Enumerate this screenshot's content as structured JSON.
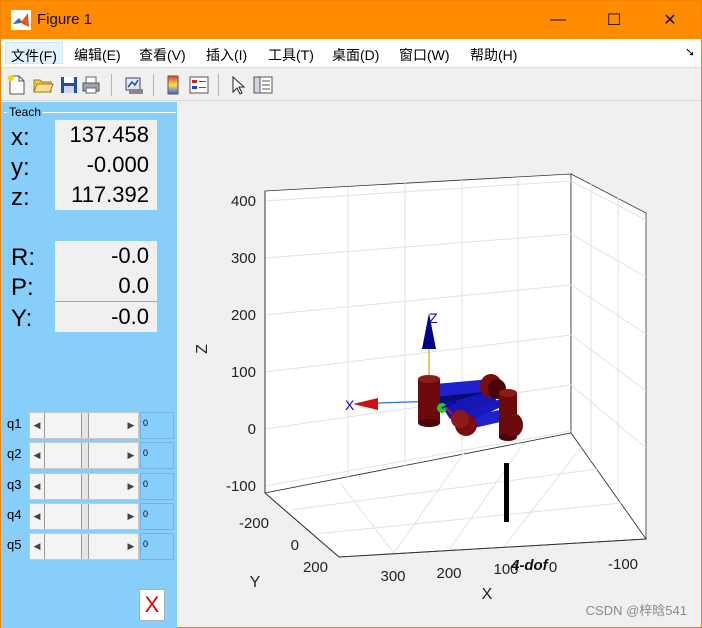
{
  "window": {
    "title": "Figure 1",
    "minimize_glyph": "—",
    "maximize_glyph": "☐",
    "close_glyph": "✕"
  },
  "menu": [
    {
      "label": "文件(F)"
    },
    {
      "label": "编辑(E)"
    },
    {
      "label": "查看(V)"
    },
    {
      "label": "插入(I)"
    },
    {
      "label": "工具(T)"
    },
    {
      "label": "桌面(D)"
    },
    {
      "label": "窗口(W)"
    },
    {
      "label": "帮助(H)"
    }
  ],
  "toolbar": {
    "icons": [
      "new-file-icon",
      "open-folder-icon",
      "save-icon",
      "print-icon",
      "link-plot-icon",
      "colorbar-icon",
      "legend-icon",
      "pointer-icon",
      "property-editor-icon"
    ]
  },
  "teach_panel": {
    "title": "Teach",
    "position": [
      {
        "label": "x:",
        "value": "137.458"
      },
      {
        "label": "y:",
        "value": "-0.000"
      },
      {
        "label": "z:",
        "value": "117.392"
      }
    ],
    "orientation": [
      {
        "label": "R:",
        "value": "-0.0"
      },
      {
        "label": "P:",
        "value": "0.0"
      },
      {
        "label": "Y:",
        "value": "-0.0"
      }
    ],
    "joints": [
      {
        "label": "q1",
        "value": "0"
      },
      {
        "label": "q2",
        "value": "0"
      },
      {
        "label": "q3",
        "value": "0"
      },
      {
        "label": "q4",
        "value": "0"
      },
      {
        "label": "q5",
        "value": "0"
      }
    ],
    "close_label": "X"
  },
  "plot": {
    "z_axis_label": "Z",
    "x_axis_label": "X",
    "y_axis_label": "Y",
    "z_ticks": [
      "400",
      "300",
      "200",
      "100",
      "0",
      "-100"
    ],
    "y_ticks": [
      "-200",
      "0",
      "200"
    ],
    "x_ticks": [
      "300",
      "200",
      "100",
      "0",
      "-100"
    ],
    "robot_name": "4-dof",
    "frame_labels": {
      "x": "X",
      "z": "Z"
    },
    "colors": {
      "link": "#1a1acc",
      "joint": "#6b0a0a",
      "x_arrow": "#cc1111",
      "z_arrow": "#00008b",
      "base": "#000000"
    }
  },
  "watermark": "CSDN @梓晗541"
}
